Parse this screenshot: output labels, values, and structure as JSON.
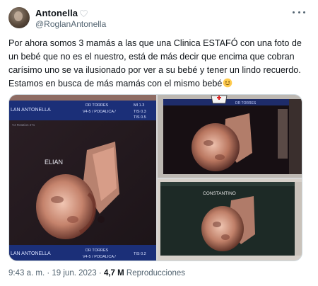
{
  "author": {
    "display_name": "Antonella",
    "handle": "@RoglanAntonella"
  },
  "tweet": {
    "text": "Por ahora somos 3 mamás a las que una Clinica ESTAFÓ con una foto de un bebé que no es el nuestro, está de más decir que encima que cobran carísimo uno se va ilusionado por ver a su bebé y tener un lindo recuerdo. Estamos en busca de más mamás con el mismo bebé"
  },
  "media": {
    "left": {
      "header_left": "LAN ANTONELLA",
      "header_mid": "DR TORRES",
      "header_mid2": "V4-5 / PODALICA /",
      "header_right1": "MI 1.3",
      "header_right2": "TIS 0.3",
      "header_right3": "TIS 0.5",
      "small_row": "V4 Rotation 271",
      "label": "ELIAN",
      "bottom_left": "LAN ANTONELLA",
      "bottom_mid": "DR TORRES",
      "bottom_mid2": "V4-5 / PODALICA /",
      "bottom_right": "TIS 0.2"
    },
    "top_right": {
      "header": "DR TORRES"
    },
    "bottom_right": {
      "label": "CONSTANTINO"
    }
  },
  "meta": {
    "time": "9:43 a. m.",
    "separator": "·",
    "date": "19 jun. 2023",
    "views_count": "4,7 M",
    "views_label": "Reproducciones"
  },
  "colors": {
    "text": "#0f1419",
    "secondary": "#536471",
    "border": "#cfd9de"
  }
}
